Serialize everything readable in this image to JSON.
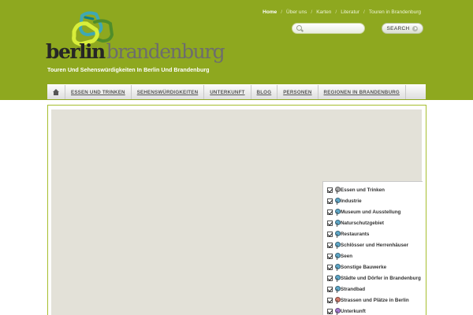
{
  "top_nav": {
    "items": [
      {
        "label": "Home",
        "active": true
      },
      {
        "label": "Über uns",
        "active": false
      },
      {
        "label": "Karten",
        "active": false
      },
      {
        "label": "Literatur",
        "active": false
      },
      {
        "label": "Touren in Brandenburg",
        "active": false
      }
    ],
    "separator": "/"
  },
  "search": {
    "placeholder": "",
    "value": "",
    "button_label": "SEARCH",
    "icon": "search-icon"
  },
  "logo": {
    "word1": "berlin",
    "word2": "brandenburg"
  },
  "tagline": "Touren Und Sehenswürdigkeiten In Berlin Und Brandenburg",
  "main_nav": {
    "home_icon": "home-icon",
    "items": [
      "ESSEN UND TRINKEN",
      "SEHENSWÜRDIGKEITEN",
      "UNTERKUNFT",
      "BLOG",
      "PERSONEN",
      "REGIONEN IN BRANDENBURG"
    ]
  },
  "legend": {
    "items": [
      {
        "label": "Essen und Trinken",
        "checked": true,
        "pin_color": "#a6a6a6"
      },
      {
        "label": "Industrie",
        "checked": true,
        "pin_color": "#5fa8c9"
      },
      {
        "label": "Museum und Ausstellung",
        "checked": true,
        "pin_color": "#5fa8c9"
      },
      {
        "label": "Naturschutzgebiet",
        "checked": true,
        "pin_color": "#5fa8c9"
      },
      {
        "label": "Restaurants",
        "checked": true,
        "pin_color": "#5fa8c9"
      },
      {
        "label": "Schlösser und Herrenhäuser",
        "checked": true,
        "pin_color": "#5fa8c9"
      },
      {
        "label": "Seen",
        "checked": true,
        "pin_color": "#5fa8c9"
      },
      {
        "label": "Sonstige Bauwerke",
        "checked": true,
        "pin_color": "#5fa8c9"
      },
      {
        "label": "Städte und Dörfer in Brandenburg",
        "checked": true,
        "pin_color": "#5fa8c9"
      },
      {
        "label": "Strandbad",
        "checked": true,
        "pin_color": "#5fa8c9"
      },
      {
        "label": "Strassen und Plätze in Berlin",
        "checked": true,
        "pin_color": "#d27a6b"
      },
      {
        "label": "Unterkunft",
        "checked": true,
        "pin_color": "#a77bd0"
      }
    ]
  },
  "colors": {
    "header_bg": "#8ea81f",
    "accent_border": "#a6be2e",
    "map_bg": "#e3e1d8"
  }
}
